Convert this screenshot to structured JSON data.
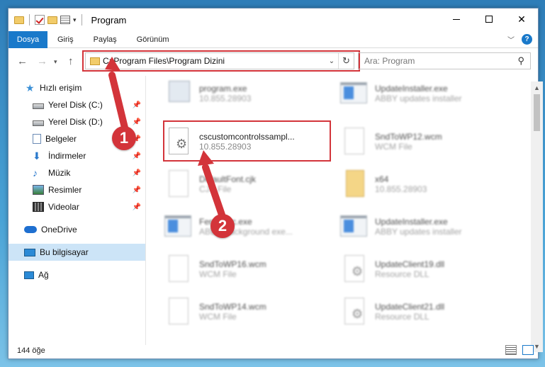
{
  "window": {
    "title": "Program"
  },
  "ribbon": {
    "tabs": [
      "Dosya",
      "Giriş",
      "Paylaş",
      "Görünüm"
    ],
    "help_label": "?"
  },
  "address": {
    "path": "C:\\Program Files\\Program Dizini"
  },
  "search": {
    "placeholder": "Ara: Program"
  },
  "sidebar": {
    "items": [
      {
        "label": "Hızlı erişim",
        "icon": "star-icon"
      },
      {
        "label": "Yerel Disk (C:)",
        "icon": "drive-icon",
        "pinned": true
      },
      {
        "label": "Yerel Disk (D:)",
        "icon": "drive-icon",
        "pinned": true
      },
      {
        "label": "Belgeler",
        "icon": "documents-icon",
        "pinned": true
      },
      {
        "label": "İndirmeler",
        "icon": "download-icon",
        "pinned": true
      },
      {
        "label": "Müzik",
        "icon": "music-icon",
        "pinned": true
      },
      {
        "label": "Resimler",
        "icon": "pictures-icon",
        "pinned": true
      },
      {
        "label": "Videolar",
        "icon": "videos-icon",
        "pinned": true
      },
      {
        "label": "OneDrive",
        "icon": "cloud-icon"
      },
      {
        "label": "Bu bilgisayar",
        "icon": "computer-icon",
        "selected": true
      },
      {
        "label": "Ağ",
        "icon": "network-icon"
      }
    ]
  },
  "files": [
    {
      "name": "program.exe",
      "desc": "10.855.28903",
      "icon": "exe-icon"
    },
    {
      "name": "UpdateInstaller.exe",
      "desc": "ABBY updates installer",
      "icon": "app-window-icon"
    },
    {
      "name": "cscustomcontrolssampl...",
      "desc": "10.855.28903",
      "icon": "dll-gear-icon",
      "highlighted": true
    },
    {
      "name": "SndToWP12.wcm",
      "desc": "WCM File",
      "icon": "blank-file-icon"
    },
    {
      "name": "DefaultFont.cjk",
      "desc": "CJK File",
      "icon": "blank-file-icon"
    },
    {
      "name": "x64",
      "desc": "10.855.28903",
      "icon": "zip-folder-icon"
    },
    {
      "name": "FerriSpec.exe",
      "desc": "ABBY Background exe...",
      "icon": "app-window-icon"
    },
    {
      "name": "UpdateInstaller.exe",
      "desc": "ABBY updates installer",
      "icon": "app-window-icon"
    },
    {
      "name": "SndToWP16.wcm",
      "desc": "WCM File",
      "icon": "blank-file-icon"
    },
    {
      "name": "UpdateClient19.dll",
      "desc": "Resource DLL",
      "icon": "dll-gear-icon"
    },
    {
      "name": "SndToWP14.wcm",
      "desc": "WCM File",
      "icon": "blank-file-icon"
    },
    {
      "name": "UpdateClient21.dll",
      "desc": "Resource DLL",
      "icon": "dll-gear-icon"
    }
  ],
  "annotations": {
    "step1": "1",
    "step2": "2",
    "color": "#d3343a"
  },
  "status": {
    "item_count": "144 öğe"
  }
}
